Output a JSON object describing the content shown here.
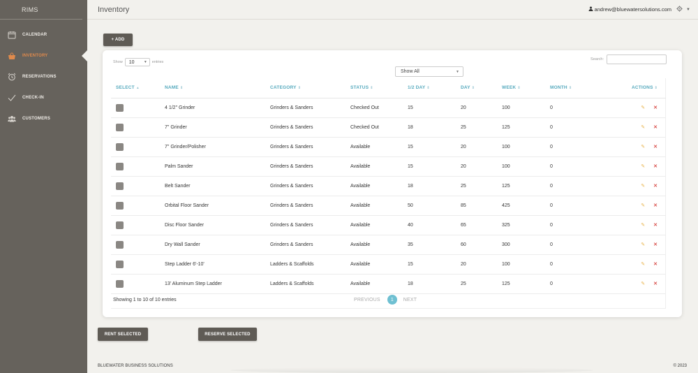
{
  "app": {
    "brand": "RIMS"
  },
  "sidebar": {
    "items": [
      {
        "label": "CALENDAR",
        "icon": "calendar-icon",
        "active": false
      },
      {
        "label": "INVENTORY",
        "icon": "basket-icon",
        "active": true
      },
      {
        "label": "RESERVATIONS",
        "icon": "alarm-clock-icon",
        "active": false
      },
      {
        "label": "CHECK-IN",
        "icon": "check-icon",
        "active": false
      },
      {
        "label": "CUSTOMERS",
        "icon": "users-icon",
        "active": false
      }
    ]
  },
  "header": {
    "title": "Inventory",
    "user_email": "andrew@bluewatersolutions.com"
  },
  "toolbar": {
    "add_label": "+ ADD"
  },
  "table_controls": {
    "show_label": "Show",
    "entries_value": "10",
    "entries_label": "entries",
    "search_label": "Search:",
    "filter_value": "Show All"
  },
  "table": {
    "columns": [
      "SELECT",
      "NAME",
      "CATEGORY",
      "STATUS",
      "1/2 DAY",
      "DAY",
      "WEEK",
      "MONTH",
      "ACTIONS"
    ],
    "rows": [
      {
        "name": "4 1/2\" Grinder",
        "category": "Grinders & Sanders",
        "status": "Checked Out",
        "half_day": "15",
        "day": "20",
        "week": "100",
        "month": "0"
      },
      {
        "name": "7\" Grinder",
        "category": "Grinders & Sanders",
        "status": "Checked Out",
        "half_day": "18",
        "day": "25",
        "week": "125",
        "month": "0"
      },
      {
        "name": "7\" Grinder/Polisher",
        "category": "Grinders & Sanders",
        "status": "Available",
        "half_day": "15",
        "day": "20",
        "week": "100",
        "month": "0"
      },
      {
        "name": "Palm Sander",
        "category": "Grinders & Sanders",
        "status": "Available",
        "half_day": "15",
        "day": "20",
        "week": "100",
        "month": "0"
      },
      {
        "name": "Belt Sander",
        "category": "Grinders & Sanders",
        "status": "Available",
        "half_day": "18",
        "day": "25",
        "week": "125",
        "month": "0"
      },
      {
        "name": "Orbital Floor Sander",
        "category": "Grinders & Sanders",
        "status": "Available",
        "half_day": "50",
        "day": "85",
        "week": "425",
        "month": "0"
      },
      {
        "name": "Disc Floor Sander",
        "category": "Grinders & Sanders",
        "status": "Available",
        "half_day": "40",
        "day": "65",
        "week": "325",
        "month": "0"
      },
      {
        "name": "Dry Wall Sander",
        "category": "Grinders & Sanders",
        "status": "Available",
        "half_day": "35",
        "day": "60",
        "week": "300",
        "month": "0"
      },
      {
        "name": "Step Ladder 6'-10'",
        "category": "Ladders & Scaffolds",
        "status": "Available",
        "half_day": "15",
        "day": "20",
        "week": "100",
        "month": "0"
      },
      {
        "name": "13' Aluminum Step Ladder",
        "category": "Ladders & Scaffolds",
        "status": "Available",
        "half_day": "18",
        "day": "25",
        "week": "125",
        "month": "0"
      }
    ],
    "info": "Showing 1 to 10 of 10 entries"
  },
  "pagination": {
    "previous": "PREVIOUS",
    "current": "1",
    "next": "NEXT"
  },
  "actions": {
    "rent_label": "RENT SELECTED",
    "reserve_label": "RESERVE SELECTED"
  },
  "footer": {
    "company": "BLUEWATER BUSINESS SOLUTIONS",
    "copyright": "© 2023"
  },
  "colors": {
    "sidebar_bg": "#66625c",
    "accent_active": "#e08a4c",
    "header_teal": "#55a9bd",
    "edit": "#e9b44c",
    "delete": "#d9534f"
  }
}
